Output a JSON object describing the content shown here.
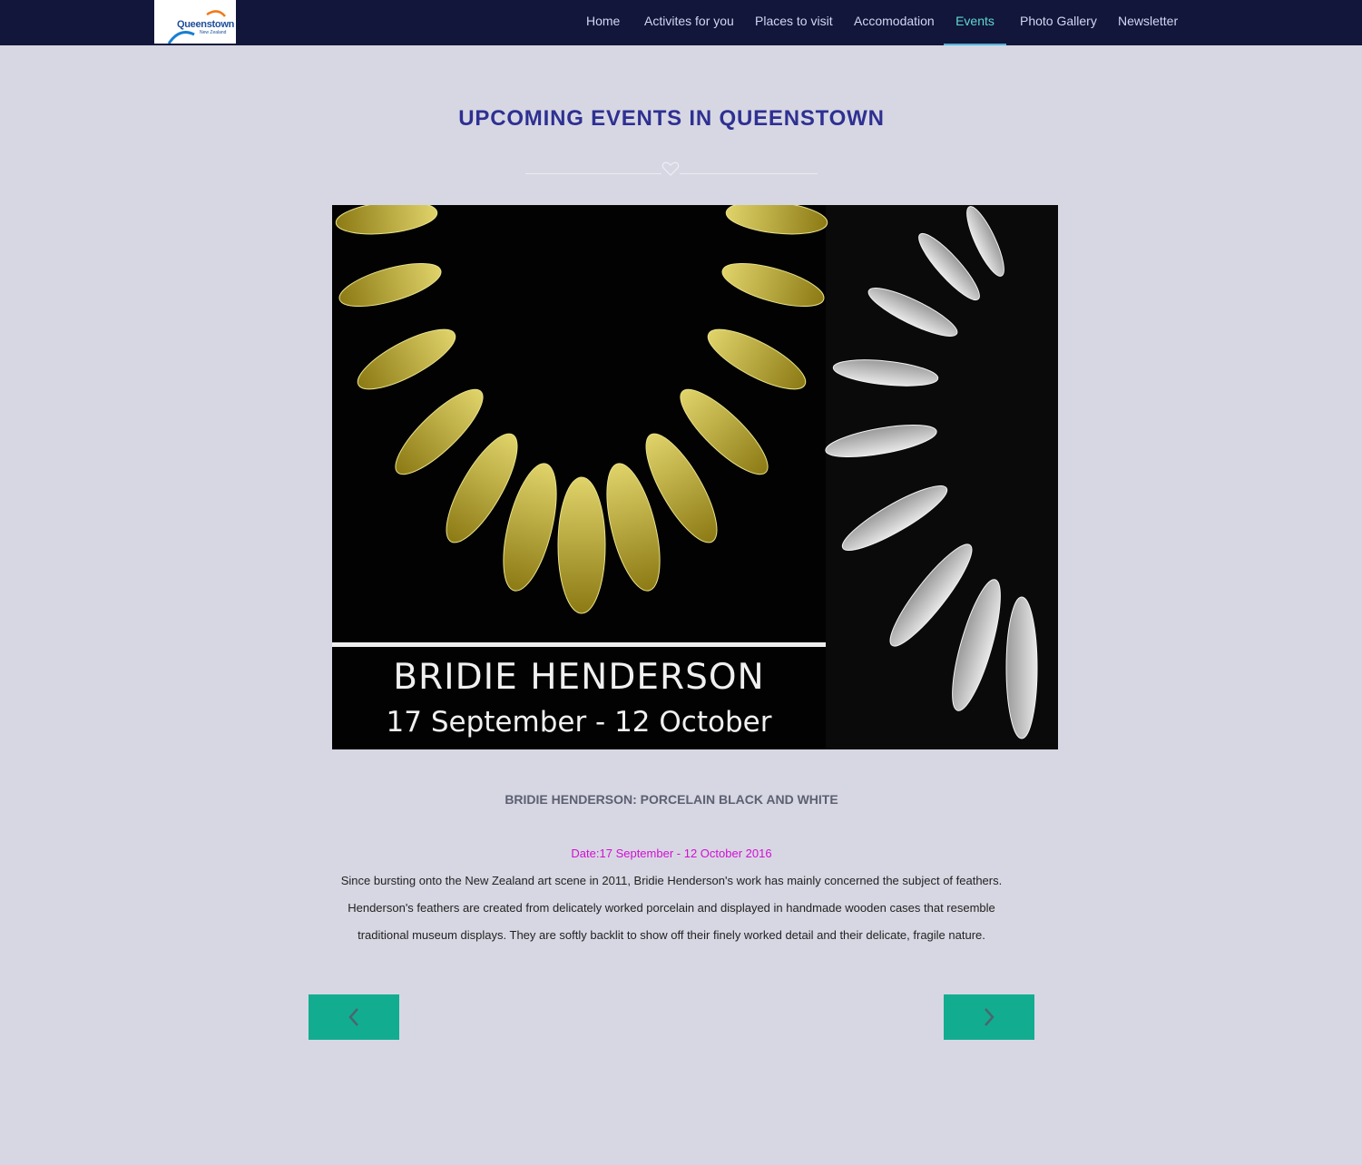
{
  "header": {
    "logo": {
      "name": "Queenstown",
      "sub": "New Zealand"
    },
    "nav": [
      {
        "label": "Home",
        "active": false
      },
      {
        "label": "Activites for you",
        "active": false
      },
      {
        "label": "Places to visit",
        "active": false
      },
      {
        "label": "Accomodation",
        "active": false
      },
      {
        "label": "Events",
        "active": true
      },
      {
        "label": "Photo Gallery",
        "active": false
      },
      {
        "label": "Newsletter",
        "active": false
      }
    ]
  },
  "main": {
    "title": "UPCOMING EVENTS IN QUEENSTOWN",
    "hero": {
      "title": "BRIDIE HENDERSON",
      "dates": "17 September - 12 October"
    },
    "event": {
      "name": "BRIDIE HENDERSON: PORCELAIN BLACK AND WHITE",
      "date": "Date:17 September - 12 October 2016",
      "description": "Since bursting onto the New Zealand art scene in 2011, Bridie Henderson's work has mainly concerned the subject of feathers. Henderson's feathers are created from delicately worked porcelain and displayed in handmade wooden cases that resemble traditional museum displays. They are softly backlit to show off their finely worked detail and their delicate, fragile nature."
    }
  },
  "icons": {
    "prev": "chevron-left-icon",
    "next": "chevron-right-icon",
    "divider": "heart-icon"
  },
  "colors": {
    "navbar": "#11163a",
    "background": "#d7d7e3",
    "title": "#2e3092",
    "active_nav": "#60d6d0",
    "date": "#d40ed4",
    "button": "#12ad90"
  }
}
